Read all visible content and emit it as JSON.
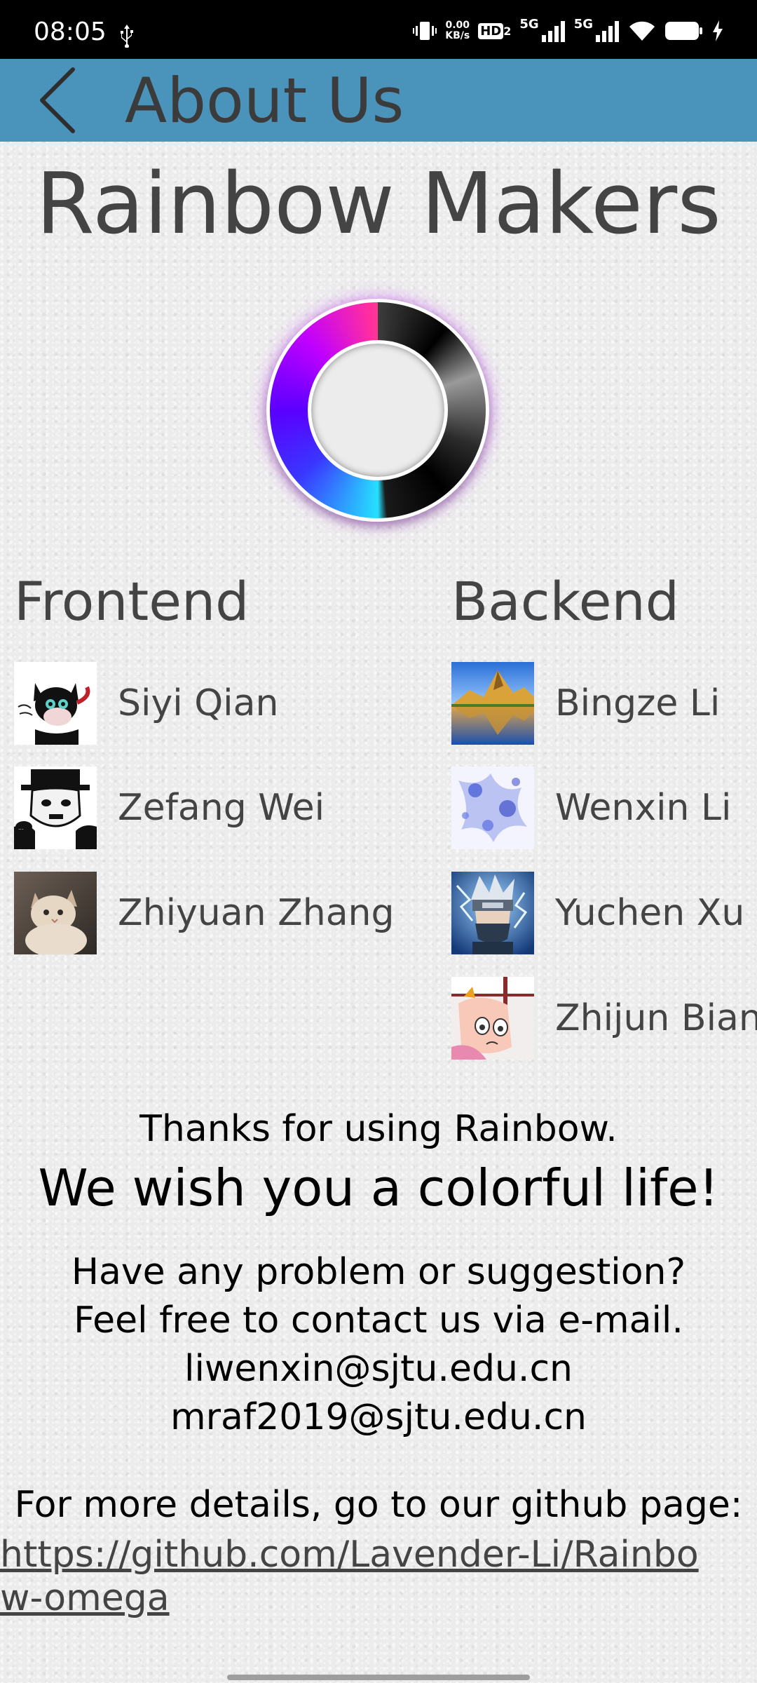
{
  "status_bar": {
    "time": "08:05",
    "net_speed_value": "0.00",
    "net_speed_unit": "KB/s",
    "hd_label": "HD",
    "hd_sub": "2",
    "signal_1_label": "5G",
    "signal_2_label": "5G",
    "icons": [
      "usb-icon",
      "vibrate-icon",
      "signal-icon",
      "wifi-icon",
      "battery-icon",
      "charging-icon"
    ]
  },
  "app_bar": {
    "title": "About Us",
    "back_icon": "chevron-left-icon",
    "background_color": "#4a93ba"
  },
  "main": {
    "team_name": "Rainbow Makers",
    "logo": "rainbow-ring-logo",
    "frontend": {
      "heading": "Frontend",
      "members": [
        {
          "name": "Siyi Qian",
          "avatar": "cat-cartoon-avatar"
        },
        {
          "name": "Zefang Wei",
          "avatar": "chaplin-avatar"
        },
        {
          "name": "Zhiyuan Zhang",
          "avatar": "kitten-photo-avatar"
        }
      ]
    },
    "backend": {
      "heading": "Backend",
      "members": [
        {
          "name": "Bingze Li",
          "avatar": "mountain-lake-avatar"
        },
        {
          "name": "Wenxin Li",
          "avatar": "blue-ink-flower-avatar"
        },
        {
          "name": "Yuchen Xu",
          "avatar": "anime-ninja-avatar"
        },
        {
          "name": "Zhijun Bian",
          "avatar": "cartoon-girl-avatar"
        }
      ]
    },
    "thanks": "Thanks for using Rainbow.",
    "wish": "We wish you a colorful life!",
    "contact_question": "Have any problem or suggestion?",
    "contact_invite": "Feel free to contact us via e-mail.",
    "emails": [
      "liwenxin@sjtu.edu.cn",
      "mraf2019@sjtu.edu.cn"
    ],
    "github_intro": "For more details, go to our github page:",
    "github_url": "https://github.com/Lavender-Li/Rainbow-omega"
  }
}
